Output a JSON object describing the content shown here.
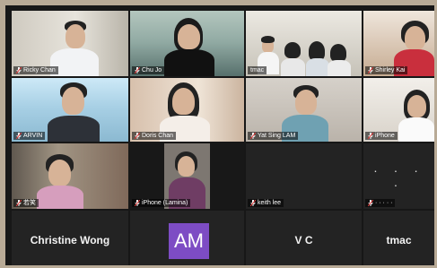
{
  "participants": [
    {
      "name": "Ricky Chan"
    },
    {
      "name": "Chu Jo"
    },
    {
      "name": "tmac"
    },
    {
      "name": "Shirley Kai"
    },
    {
      "name": "ARVIN"
    },
    {
      "name": "Doris Chan"
    },
    {
      "name": "Yat Sing LAM"
    },
    {
      "name": "iPhone"
    },
    {
      "name": "若笑"
    },
    {
      "name": "iPhone (Lamina)"
    },
    {
      "name": "keith lee"
    },
    {
      "name": "· · · · ·"
    },
    {
      "name": "Christine Wong",
      "display": "Christine Wong"
    },
    {
      "name": "AM",
      "avatar": "AM"
    },
    {
      "name": "V C",
      "display": "V C"
    },
    {
      "name": "tmac",
      "display": "tmac"
    }
  ],
  "placeholder_dots": "· · · ·",
  "colors": {
    "active_border": "#d8ea2f",
    "avatar_purple": "#7d4cc4",
    "tile": "#232323",
    "mic_muted": "#e23b3b"
  }
}
